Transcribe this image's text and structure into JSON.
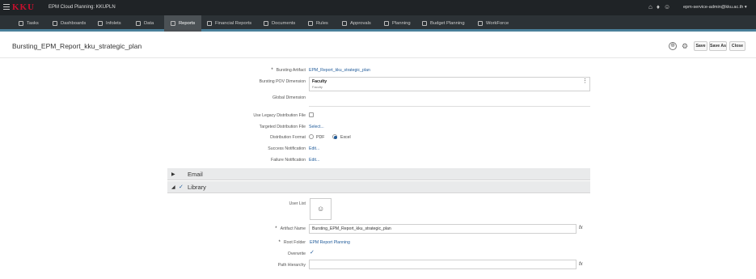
{
  "topbar": {
    "logo_text": "KKU",
    "app_title": "EPM Cloud Planning: KKUPLN",
    "user": "epm-service-admin@kku.ac.th ▾",
    "icons": [
      "home-icon",
      "microphone-icon",
      "accessibility-icon"
    ]
  },
  "nav": {
    "tabs": [
      {
        "label": "Tasks"
      },
      {
        "label": "Dashboards"
      },
      {
        "label": "Infolets"
      },
      {
        "label": "Data"
      },
      {
        "label": "Reports"
      },
      {
        "label": "Financial Reports"
      },
      {
        "label": "Documents"
      },
      {
        "label": "Rules"
      },
      {
        "label": "Approvals"
      },
      {
        "label": "Planning"
      },
      {
        "label": "Budget Planning"
      },
      {
        "label": "WorkForce"
      }
    ],
    "active": "Reports"
  },
  "header": {
    "title": "Bursting_EPM_Report_kku_strategic_plan",
    "save": "Save",
    "save_as": "Save As",
    "close": "Close"
  },
  "form": {
    "bursting_artifact_label": "Bursting Artifact",
    "bursting_artifact_value": "EPM_Report_kku_strategic_plan",
    "pov_label": "Bursting POV Dimension",
    "pov_value": "Faculty",
    "pov_sub": "Faculty",
    "global_dim_label": "Global Dimension",
    "legacy_label": "Use Legacy Distribution File",
    "targeted_label": "Targeted Distribution File",
    "targeted_value": "Select...",
    "format_label": "Distribution Format",
    "format_pdf": "PDF",
    "format_excel": "Excel",
    "format_selected": "Excel",
    "success_label": "Success Notification",
    "success_value": "Edit...",
    "failure_label": "Failure Notification",
    "failure_value": "Edit..."
  },
  "sections": {
    "email": "Email",
    "library": "Library"
  },
  "library": {
    "user_list_label": "User List",
    "artifact_name_label": "Artifact Name",
    "artifact_name_value": "Bursting_EPM_Report_kku_strategic_plan",
    "root_folder_label": "Root Folder",
    "root_folder_value": "EPM Report Planning",
    "overwrite_label": "Overwrite",
    "path_hierarchy_label": "Path Hierarchy",
    "path_hierarchy_value": "",
    "fx": "fx"
  }
}
